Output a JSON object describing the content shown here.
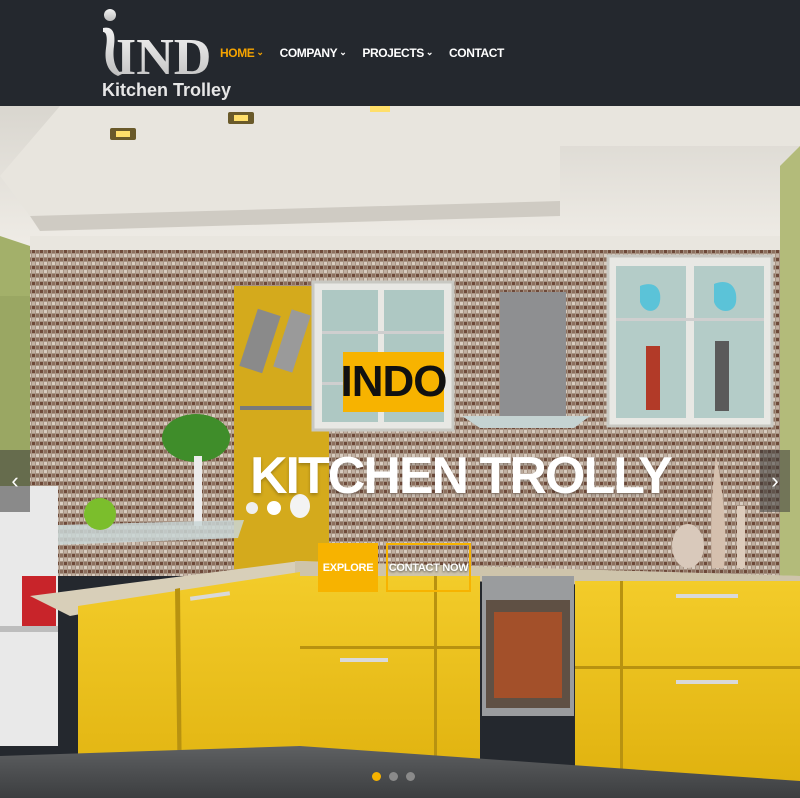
{
  "colors": {
    "header_bg": "#24282e",
    "accent": "#f7b300",
    "nav_active": "#f5a300",
    "nav_text": "#ffffff"
  },
  "logo": {
    "word": "INDO",
    "subtitle": "Kitchen Trolley"
  },
  "nav": {
    "items": [
      {
        "label": "HOME",
        "active": true,
        "has_dropdown": true
      },
      {
        "label": "COMPANY",
        "active": false,
        "has_dropdown": true
      },
      {
        "label": "PROJECTS",
        "active": false,
        "has_dropdown": true
      },
      {
        "label": "CONTACT",
        "active": false,
        "has_dropdown": false
      }
    ],
    "chevron_icon": "chevron-down-icon"
  },
  "hero": {
    "brand": "INDO",
    "headline": "KITCHEN TROLLY",
    "buttons": {
      "explore": "EXPLORE",
      "contact": "CONTACT NOW"
    },
    "prev_icon": "chevron-left-icon",
    "next_icon": "chevron-right-icon",
    "slides": {
      "count": 3,
      "active_index": 0
    }
  }
}
